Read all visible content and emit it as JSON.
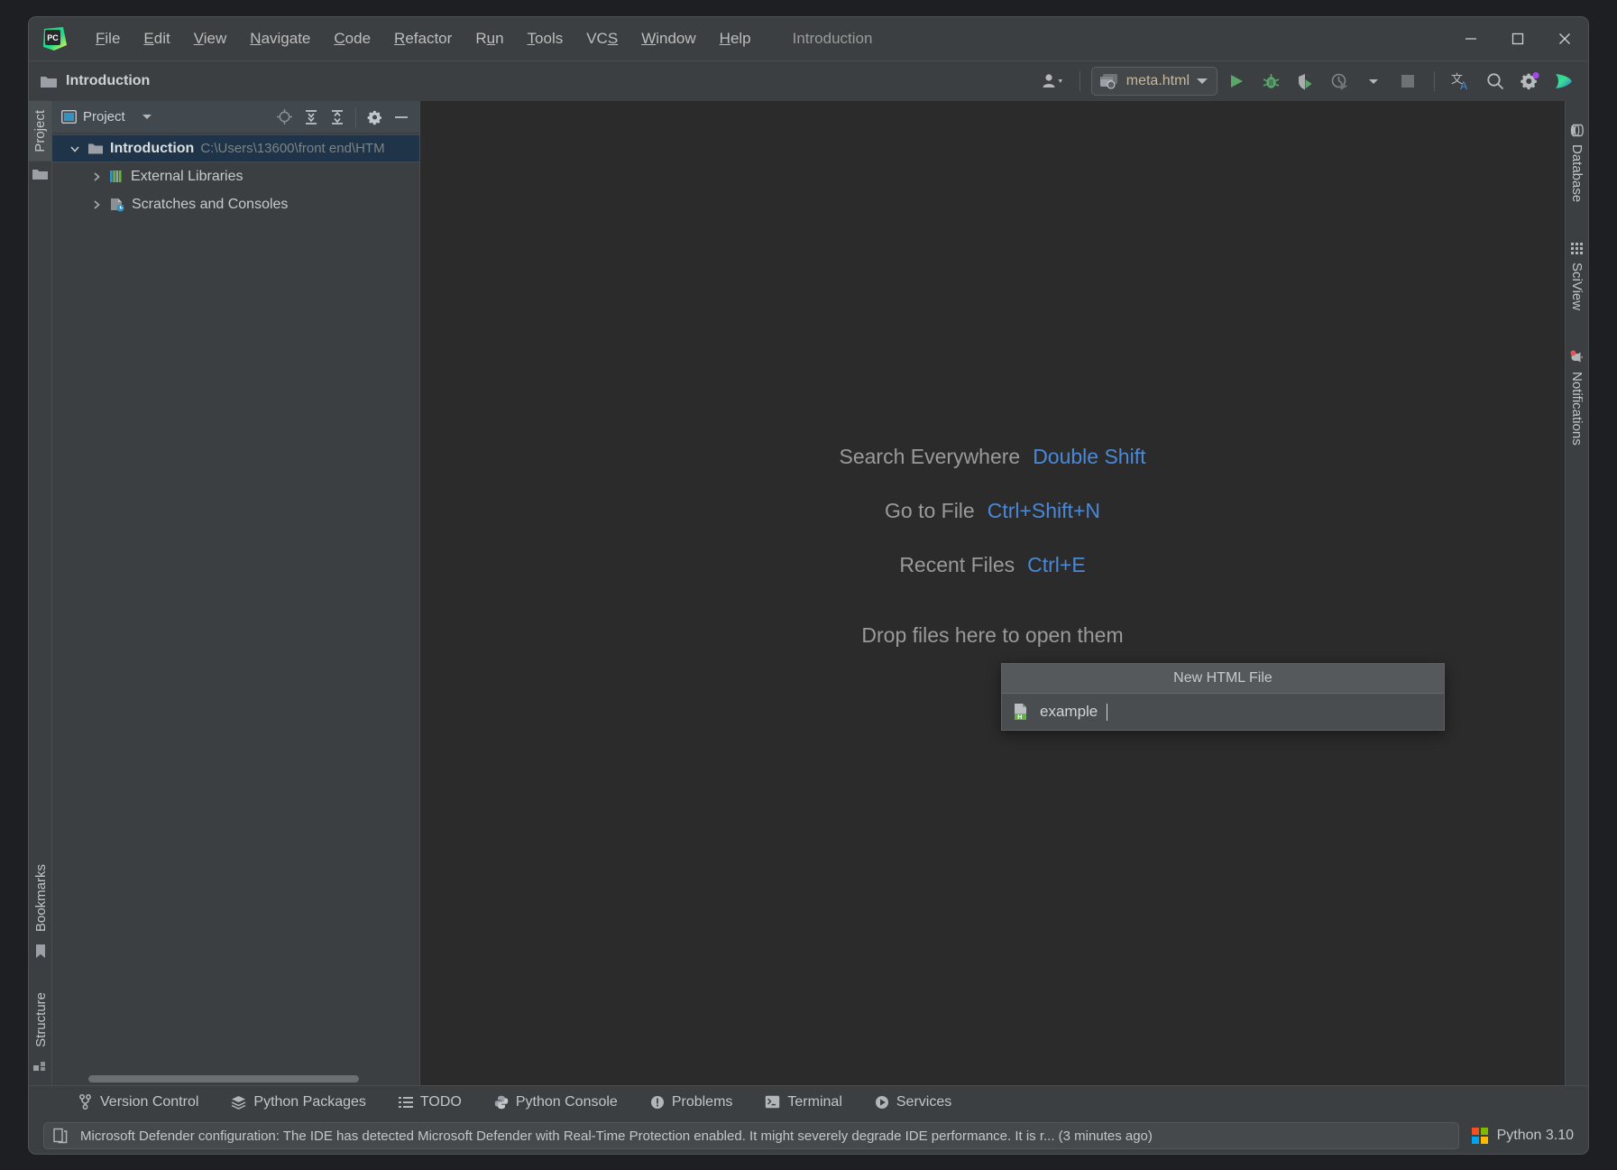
{
  "titlebar": {
    "logo_icon": "pycharm-logo-icon",
    "project_title": "Introduction",
    "menus": [
      {
        "label": "File",
        "mnemonic": "F"
      },
      {
        "label": "Edit",
        "mnemonic": "E"
      },
      {
        "label": "View",
        "mnemonic": "V"
      },
      {
        "label": "Navigate",
        "mnemonic": "N"
      },
      {
        "label": "Code",
        "mnemonic": "C"
      },
      {
        "label": "Refactor",
        "mnemonic": "R"
      },
      {
        "label": "Run",
        "mnemonic": "u"
      },
      {
        "label": "Tools",
        "mnemonic": "T"
      },
      {
        "label": "VCS",
        "mnemonic": "S"
      },
      {
        "label": "Window",
        "mnemonic": "W"
      },
      {
        "label": "Help",
        "mnemonic": "H"
      }
    ],
    "window_controls": {
      "minimize": "minimize-icon",
      "maximize": "maximize-icon",
      "close": "close-icon"
    }
  },
  "toolbar": {
    "breadcrumb": "Introduction",
    "breadcrumb_icon": "folder-icon",
    "account_icon": "account-icon",
    "run_config": {
      "label": "meta.html",
      "icon": "html-browser-icon"
    },
    "actions": [
      {
        "name": "run-button",
        "tooltip": "Run"
      },
      {
        "name": "debug-button",
        "tooltip": "Debug"
      },
      {
        "name": "run-coverage-button",
        "tooltip": "Run with Coverage"
      },
      {
        "name": "profile-button",
        "tooltip": "Profile"
      },
      {
        "name": "stop-button",
        "tooltip": "Stop"
      },
      {
        "name": "translate-button",
        "tooltip": "Translate"
      },
      {
        "name": "search-button",
        "tooltip": "Search Everywhere"
      },
      {
        "name": "settings-button",
        "tooltip": "Settings"
      },
      {
        "name": "updates-button",
        "tooltip": "Updates"
      }
    ]
  },
  "left_stripe": {
    "top": [
      {
        "label": "Project",
        "icon": "folder-icon",
        "active": true
      }
    ],
    "bottom": [
      {
        "label": "Bookmarks",
        "icon": "bookmark-icon"
      },
      {
        "label": "Structure",
        "icon": "structure-icon"
      }
    ]
  },
  "right_stripe": [
    {
      "label": "Database",
      "icon": "database-icon"
    },
    {
      "label": "SciView",
      "icon": "grid-icon"
    },
    {
      "label": "Notifications",
      "icon": "bell-icon",
      "badge": true
    }
  ],
  "project_panel": {
    "title": "Project",
    "header_icons": [
      {
        "name": "locate-file-icon"
      },
      {
        "name": "expand-all-icon"
      },
      {
        "name": "collapse-all-icon"
      },
      {
        "name": "gear-icon"
      },
      {
        "name": "hide-panel-icon"
      }
    ],
    "tree": [
      {
        "label": "Introduction",
        "secondary": "C:\\Users\\13600\\front end\\HTM",
        "icon": "folder-icon",
        "expanded": true,
        "selected": true,
        "depth": 0
      },
      {
        "label": "External Libraries",
        "secondary": "",
        "icon": "libraries-icon",
        "expanded": false,
        "selected": false,
        "depth": 1
      },
      {
        "label": "Scratches and Consoles",
        "secondary": "",
        "icon": "scratches-icon",
        "expanded": false,
        "selected": false,
        "depth": 1
      }
    ]
  },
  "editor": {
    "hints": [
      {
        "key": "Search Everywhere",
        "shortcut": "Double Shift"
      },
      {
        "key": "Go to File",
        "shortcut": "Ctrl+Shift+N"
      },
      {
        "key": "Recent Files",
        "shortcut": "Ctrl+E"
      }
    ],
    "drop_hint": "Drop files here to open them"
  },
  "popup": {
    "title": "New HTML File",
    "value": "example",
    "placeholder": "",
    "file_icon": "html5-file-icon"
  },
  "tool_window_bar": [
    {
      "label": "Version Control",
      "icon": "branch-icon"
    },
    {
      "label": "Python Packages",
      "icon": "layers-icon"
    },
    {
      "label": "TODO",
      "icon": "list-icon"
    },
    {
      "label": "Python Console",
      "icon": "python-icon"
    },
    {
      "label": "Problems",
      "icon": "warning-icon"
    },
    {
      "label": "Terminal",
      "icon": "terminal-icon"
    },
    {
      "label": "Services",
      "icon": "services-icon"
    }
  ],
  "status_bar": {
    "notification_icon": "notification-log-icon",
    "notification": "Microsoft Defender configuration: The IDE has detected Microsoft Defender with Real-Time Protection enabled. It might severely degrade IDE performance. It is r... (3 minutes ago)",
    "interpreter": "Python 3.10",
    "interpreter_icon": "microsoft-logo-icon"
  },
  "colors": {
    "accent_blue": "#4a88d8",
    "run_green": "#499c54",
    "selection_blue": "#1f3449",
    "panel_bg": "#3c3f41",
    "editor_bg": "#2b2b2b"
  }
}
